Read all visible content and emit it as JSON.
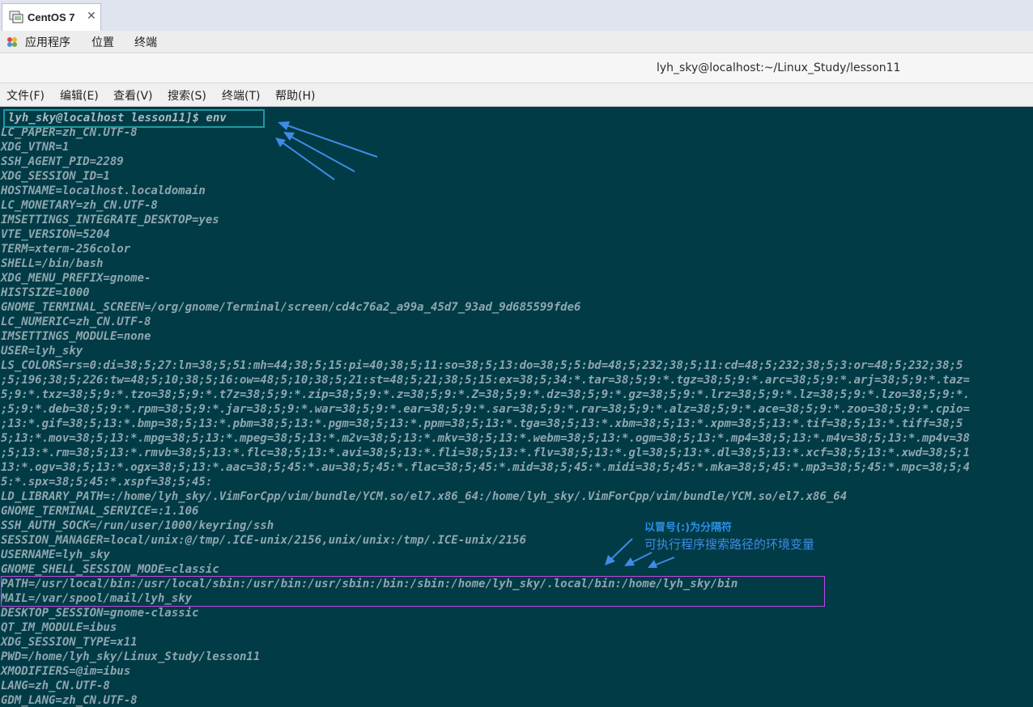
{
  "vm_tab": {
    "title": "CentOS 7",
    "close_glyph": "✕",
    "icon": "vm-icon"
  },
  "gnome_bar": {
    "apps_icon": "applications-icon",
    "items": [
      "应用程序",
      "位置",
      "终端"
    ]
  },
  "window": {
    "title": "lyh_sky@localhost:~/Linux_Study/lesson11"
  },
  "menu": {
    "items": [
      "文件(F)",
      "编辑(E)",
      "查看(V)",
      "搜索(S)",
      "终端(T)",
      "帮助(H)"
    ]
  },
  "terminal": {
    "colors": {
      "background": "#003b46",
      "text": "#8fa7af",
      "env_highlight": "#1e9aa0",
      "path_highlight": "#c045e0",
      "annotation": "#3f8be6"
    },
    "prompt": "lyh_sky@localhost lesson11]$ env",
    "lines": [
      "LC_PAPER=zh_CN.UTF-8",
      "XDG_VTNR=1",
      "SSH_AGENT_PID=2289",
      "XDG_SESSION_ID=1",
      "HOSTNAME=localhost.localdomain",
      "LC_MONETARY=zh_CN.UTF-8",
      "IMSETTINGS_INTEGRATE_DESKTOP=yes",
      "VTE_VERSION=5204",
      "TERM=xterm-256color",
      "SHELL=/bin/bash",
      "XDG_MENU_PREFIX=gnome-",
      "HISTSIZE=1000",
      "GNOME_TERMINAL_SCREEN=/org/gnome/Terminal/screen/cd4c76a2_a99a_45d7_93ad_9d685599fde6",
      "LC_NUMERIC=zh_CN.UTF-8",
      "IMSETTINGS_MODULE=none",
      "USER=lyh_sky",
      "LS_COLORS=rs=0:di=38;5;27:ln=38;5;51:mh=44;38;5;15:pi=40;38;5;11:so=38;5;13:do=38;5;5:bd=48;5;232;38;5;11:cd=48;5;232;38;5;3:or=48;5;232;38;5",
      ";5;196;38;5;226:tw=48;5;10;38;5;16:ow=48;5;10;38;5;21:st=48;5;21;38;5;15:ex=38;5;34:*.tar=38;5;9:*.tgz=38;5;9:*.arc=38;5;9:*.arj=38;5;9:*.taz=",
      "5;9:*.txz=38;5;9:*.tzo=38;5;9:*.t7z=38;5;9:*.zip=38;5;9:*.z=38;5;9:*.Z=38;5;9:*.dz=38;5;9:*.gz=38;5;9:*.lrz=38;5;9:*.lz=38;5;9:*.lzo=38;5;9:*.",
      ";5;9:*.deb=38;5;9:*.rpm=38;5;9:*.jar=38;5;9:*.war=38;5;9:*.ear=38;5;9:*.sar=38;5;9:*.rar=38;5;9:*.alz=38;5;9:*.ace=38;5;9:*.zoo=38;5;9:*.cpio=",
      ";13:*.gif=38;5;13:*.bmp=38;5;13:*.pbm=38;5;13:*.pgm=38;5;13:*.ppm=38;5;13:*.tga=38;5;13:*.xbm=38;5;13:*.xpm=38;5;13:*.tif=38;5;13:*.tiff=38;5",
      "5;13:*.mov=38;5;13:*.mpg=38;5;13:*.mpeg=38;5;13:*.m2v=38;5;13:*.mkv=38;5;13:*.webm=38;5;13:*.ogm=38;5;13:*.mp4=38;5;13:*.m4v=38;5;13:*.mp4v=38",
      ";5;13:*.rm=38;5;13:*.rmvb=38;5;13:*.flc=38;5;13:*.avi=38;5;13:*.fli=38;5;13:*.flv=38;5;13:*.gl=38;5;13:*.dl=38;5;13:*.xcf=38;5;13:*.xwd=38;5;1",
      "13:*.ogv=38;5;13:*.ogx=38;5;13:*.aac=38;5;45:*.au=38;5;45:*.flac=38;5;45:*.mid=38;5;45:*.midi=38;5;45:*.mka=38;5;45:*.mp3=38;5;45:*.mpc=38;5;4",
      "5:*.spx=38;5;45:*.xspf=38;5;45:",
      "LD_LIBRARY_PATH=:/home/lyh_sky/.VimForCpp/vim/bundle/YCM.so/el7.x86_64:/home/lyh_sky/.VimForCpp/vim/bundle/YCM.so/el7.x86_64",
      "GNOME_TERMINAL_SERVICE=:1.106",
      "SSH_AUTH_SOCK=/run/user/1000/keyring/ssh",
      "SESSION_MANAGER=local/unix:@/tmp/.ICE-unix/2156,unix/unix:/tmp/.ICE-unix/2156",
      "USERNAME=lyh_sky",
      "GNOME_SHELL_SESSION_MODE=classic",
      "PATH=/usr/local/bin:/usr/local/sbin:/usr/bin:/usr/sbin:/bin:/sbin:/home/lyh_sky/.local/bin:/home/lyh_sky/bin",
      "MAIL=/var/spool/mail/lyh_sky",
      "DESKTOP_SESSION=gnome-classic",
      "QT_IM_MODULE=ibus",
      "XDG_SESSION_TYPE=x11",
      "PWD=/home/lyh_sky/Linux_Study/lesson11",
      "XMODIFIERS=@im=ibus",
      "LANG=zh_CN.UTF-8",
      "GDM_LANG=zh_CN.UTF-8"
    ]
  },
  "annotations": {
    "colon_note": "以冒号(:)为分隔符",
    "path_note": "可执行程序搜索路径的环境变量"
  }
}
